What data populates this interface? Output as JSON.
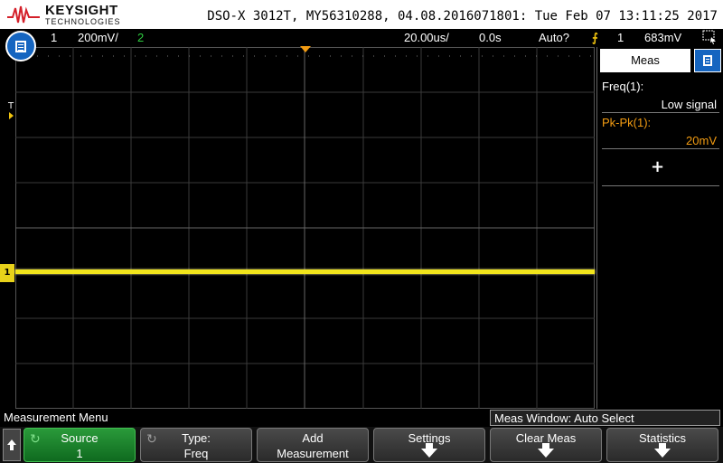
{
  "header": {
    "brand": "KEYSIGHT",
    "brand_sub": "TECHNOLOGIES",
    "title": "DSO-X 3012T, MY56310288, 04.08.2016071801: Tue Feb 07 13:11:25 2017"
  },
  "status": {
    "ch1_num": "1",
    "ch1_scale": "200mV/",
    "ch2_num": "2",
    "timebase": "20.00us/",
    "delay": "0.0s",
    "trigger_mode": "Auto?",
    "trigger_source": "1",
    "trigger_level": "683mV"
  },
  "scope": {
    "trigger_marker_label": "T",
    "ch1_marker_label": "1"
  },
  "meas_panel": {
    "tab_label": "Meas",
    "m1_label": "Freq(1):",
    "m1_value": "Low signal",
    "m2_label": "Pk-Pk(1):",
    "m2_value": "20mV",
    "add_symbol": "+"
  },
  "menu": {
    "title": "Measurement Menu",
    "meas_window": "Meas Window: Auto Select",
    "softkeys": [
      {
        "line1": "Source",
        "line2": "1"
      },
      {
        "line1": "Type:",
        "line2": "Freq"
      },
      {
        "line1": "Add",
        "line2": "Measurement"
      },
      {
        "line1": "Settings",
        "line2": ""
      },
      {
        "line1": "Clear Meas",
        "line2": ""
      },
      {
        "line1": "Statistics",
        "line2": ""
      }
    ]
  },
  "colors": {
    "ch1": "#f2e51c",
    "ch2": "#2ecc40",
    "trigger": "#f39c12",
    "accent": "#1565c0"
  }
}
